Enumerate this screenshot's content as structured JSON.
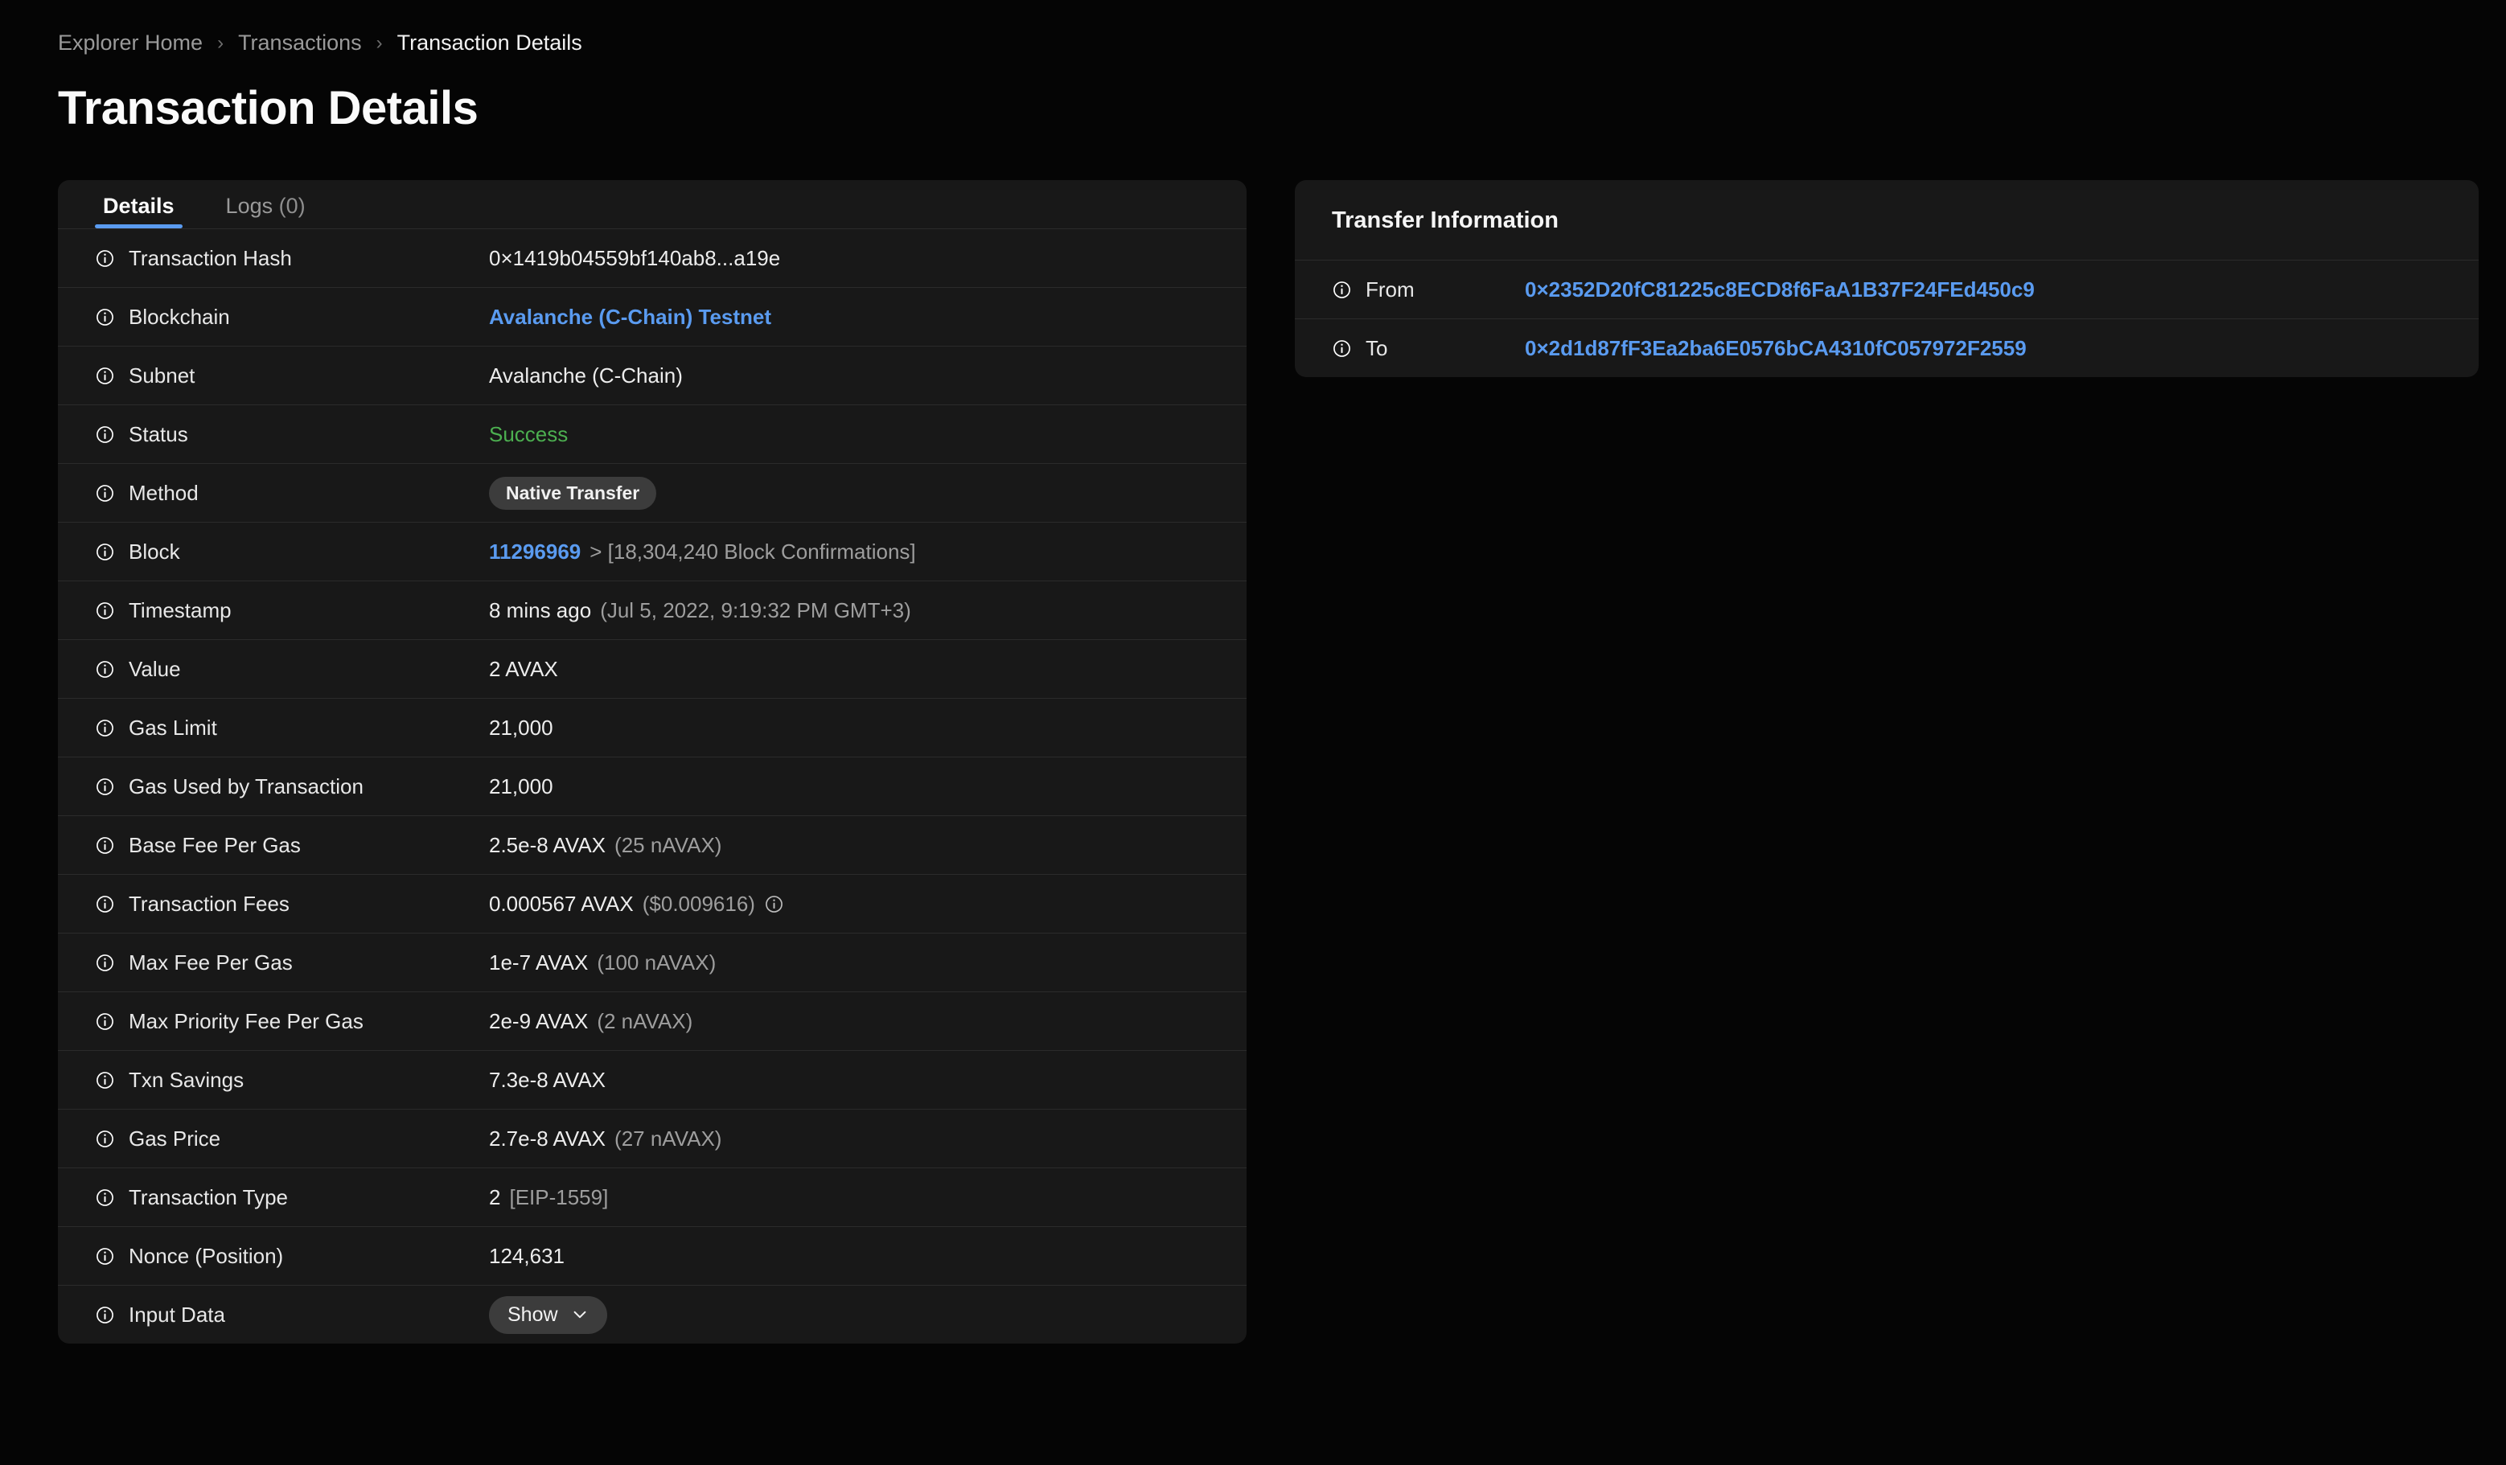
{
  "breadcrumb": {
    "items": [
      {
        "label": "Explorer Home",
        "current": false
      },
      {
        "label": "Transactions",
        "current": false
      },
      {
        "label": "Transaction Details",
        "current": true
      }
    ],
    "separator": "›"
  },
  "page_title": "Transaction Details",
  "colors": {
    "accent_blue": "#5a9bf0",
    "success_green": "#4caf50",
    "card_bg": "#181818",
    "page_bg": "#050505",
    "badge_bg": "#3c3c3c",
    "divider": "#2b2b2b"
  },
  "details_panel": {
    "tabs": [
      {
        "label": "Details",
        "count": "",
        "active": true
      },
      {
        "label": "Logs",
        "count": "(0)",
        "active": false
      }
    ],
    "rows": [
      {
        "label": "Transaction Hash",
        "value": "0×1419b04559bf140ab8...a19e"
      },
      {
        "label": "Blockchain",
        "value": "Avalanche (C-Chain) Testnet",
        "style": "link-bold"
      },
      {
        "label": "Subnet",
        "value": "Avalanche (C-Chain)"
      },
      {
        "label": "Status",
        "value": "Success",
        "style": "success"
      },
      {
        "label": "Method",
        "value": "Native Transfer",
        "style": "badge"
      },
      {
        "label": "Block",
        "value": "11296969",
        "style": "link-bold",
        "suffix": "> [18,304,240 Block Confirmations]"
      },
      {
        "label": "Timestamp",
        "value": "8 mins ago",
        "suffix": "(Jul 5, 2022, 9:19:32 PM GMT+3)"
      },
      {
        "label": "Value",
        "value": "2 AVAX"
      },
      {
        "label": "Gas Limit",
        "value": "21,000"
      },
      {
        "label": "Gas Used by Transaction",
        "value": "21,000"
      },
      {
        "label": "Base Fee Per Gas",
        "value": "2.5e-8 AVAX",
        "suffix": "(25 nAVAX)"
      },
      {
        "label": "Transaction Fees",
        "value": "0.000567 AVAX",
        "suffix": "($0.009616)",
        "trailing_icon": "info-icon"
      },
      {
        "label": "Max Fee Per Gas",
        "value": "1e-7 AVAX",
        "suffix": "(100 nAVAX)"
      },
      {
        "label": "Max Priority Fee Per Gas",
        "value": "2e-9 AVAX",
        "suffix": "(2 nAVAX)"
      },
      {
        "label": "Txn Savings",
        "value": "7.3e-8 AVAX"
      },
      {
        "label": "Gas Price",
        "value": "2.7e-8 AVAX",
        "suffix": "(27 nAVAX)"
      },
      {
        "label": "Transaction Type",
        "value": "2",
        "suffix": "[EIP-1559]"
      },
      {
        "label": "Nonce (Position)",
        "value": "124,631"
      },
      {
        "label": "Input Data",
        "value": "Show",
        "style": "show-button"
      }
    ]
  },
  "transfer_panel": {
    "title": "Transfer Information",
    "rows": [
      {
        "label": "From",
        "value": "0×2352D20fC81225c8ECD8f6FaA1B37F24FEd450c9",
        "style": "link-bold"
      },
      {
        "label": "To",
        "value": "0×2d1d87fF3Ea2ba6E0576bCA4310fC057972F2559",
        "style": "link-bold"
      }
    ]
  }
}
